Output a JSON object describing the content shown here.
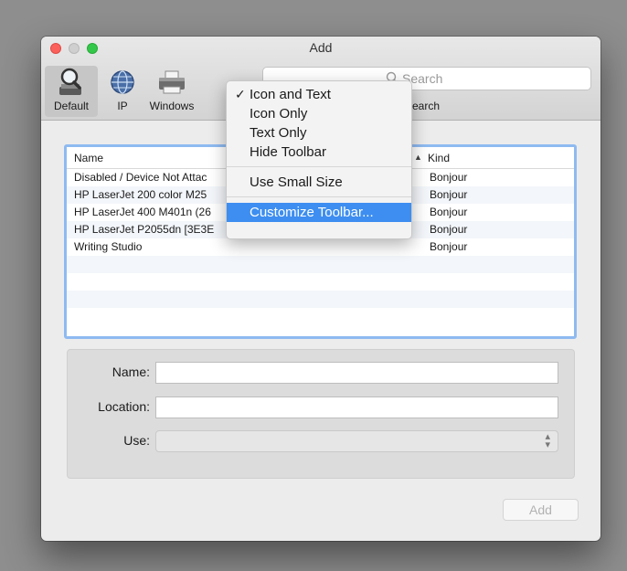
{
  "window": {
    "title": "Add"
  },
  "toolbar": {
    "items": [
      {
        "label": "Default",
        "icon": "default-magnifier-icon"
      },
      {
        "label": "IP",
        "icon": "globe-icon"
      },
      {
        "label": "Windows",
        "icon": "printer-icon"
      },
      {
        "label": "Search"
      }
    ],
    "search_placeholder": "Search"
  },
  "context_menu": {
    "items": [
      {
        "label": "Icon and Text",
        "checked": true
      },
      {
        "label": "Icon Only"
      },
      {
        "label": "Text Only"
      },
      {
        "label": "Hide Toolbar"
      },
      {
        "label": "Use Small Size"
      },
      {
        "label": "Customize Toolbar...",
        "selected": true
      }
    ]
  },
  "printer_list": {
    "columns": {
      "name": "Name",
      "kind": "Kind"
    },
    "rows": [
      {
        "name": "Disabled / Device Not Attac",
        "kind": "Bonjour"
      },
      {
        "name": "HP LaserJet 200 color M25",
        "kind": "Bonjour"
      },
      {
        "name": "HP LaserJet 400 M401n (26",
        "kind": "Bonjour"
      },
      {
        "name": "HP LaserJet P2055dn [3E3E",
        "kind": "Bonjour"
      },
      {
        "name": "Writing Studio",
        "kind": "Bonjour"
      },
      {
        "name": "",
        "kind": ""
      },
      {
        "name": "",
        "kind": ""
      },
      {
        "name": "",
        "kind": ""
      },
      {
        "name": "",
        "kind": ""
      }
    ]
  },
  "form": {
    "name_label": "Name:",
    "name_value": "",
    "location_label": "Location:",
    "location_value": "",
    "use_label": "Use:",
    "use_value": ""
  },
  "buttons": {
    "add": "Add"
  },
  "colors": {
    "accent": "#3d8ef0",
    "close": "#fc605b",
    "zoom": "#34c84a",
    "list_focus": "#8ebaf0"
  }
}
